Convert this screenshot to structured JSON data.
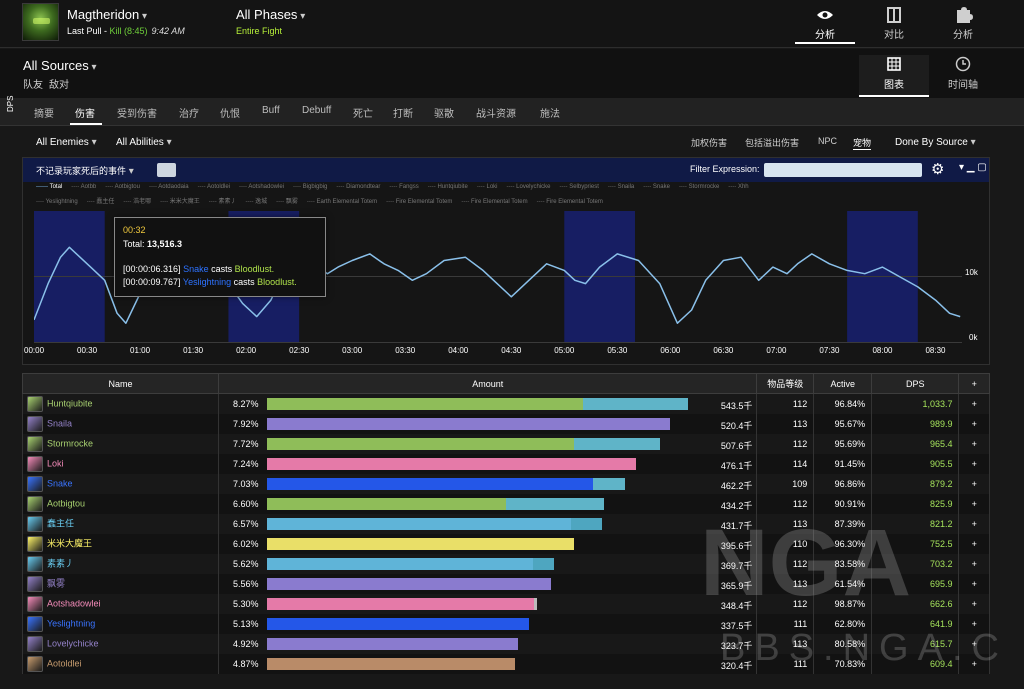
{
  "header": {
    "boss_name": "Magtheridon",
    "pull_label": "Last Pull - ",
    "kill_label": "Kill (8:45)",
    "pull_time": "9:42 AM",
    "phases": "All Phases",
    "fight": "Entire Fight",
    "nav": [
      {
        "label": "分析",
        "icon": "eye-icon",
        "active": true
      },
      {
        "label": "对比",
        "icon": "compare-icon",
        "active": false
      },
      {
        "label": "分析",
        "icon": "puzzle-icon",
        "active": false
      }
    ]
  },
  "sources": {
    "label": "All Sources",
    "teams": [
      "队友",
      "敌对"
    ],
    "views": [
      {
        "label": "图表",
        "icon": "table-icon",
        "active": true
      },
      {
        "label": "时间轴",
        "icon": "clock-icon",
        "active": false
      }
    ]
  },
  "tabs": [
    "摘要",
    "伤害",
    "受到伤害",
    "治疗",
    "仇恨",
    "Buff",
    "Debuff",
    "死亡",
    "打断",
    "驱散",
    "战斗资源",
    "施法"
  ],
  "active_tab": "伤害",
  "filters": {
    "enemies": "All Enemies",
    "abilities": "All Abilities",
    "options": [
      "加权伤害",
      "包括溢出伤害",
      "NPC",
      "宠物"
    ],
    "active_option": "宠物",
    "done_by": "Done By Source"
  },
  "chart_controls": {
    "deaths_toggle": "不记录玩家死后的事件",
    "filter_label": "Filter Expression:",
    "filter_value": "",
    "gear": "⚙",
    "window_controls": "▾ ▁ ▢"
  },
  "chart_data": {
    "type": "line",
    "title": "",
    "xlabel": "",
    "ylabel": "DPS",
    "x_ticks": [
      "00:00",
      "00:30",
      "01:00",
      "01:30",
      "02:00",
      "02:30",
      "03:00",
      "03:30",
      "04:00",
      "04:30",
      "05:00",
      "05:30",
      "06:00",
      "06:30",
      "07:00",
      "07:30",
      "08:00",
      "08:30"
    ],
    "y_ticks": [
      "0k",
      "10k"
    ],
    "ylim": [
      0,
      20000
    ],
    "legend": [
      [
        "Total",
        "Aotbb",
        "Aotbigtou",
        "Aotdaodaia",
        "Aotoldlei",
        "Aotshadowlei",
        "Bigbigbig",
        "Diamondtear",
        "Fangss",
        "Huntqiubite",
        "Loki",
        "Lovelychicke",
        "Selbypriest",
        "Snaila",
        "Snake",
        "Stormrocke",
        "Xhh"
      ],
      [
        "Yeslightning",
        "蠢主任",
        "浩老哪",
        "米米大魔王",
        "素素丿",
        "逸城",
        "飘雾",
        "Earth Elemental Totem",
        "Fire Elemental Totem",
        "Fire Elemental Totem",
        "Fire Elemental Totem"
      ]
    ],
    "bloodlust_windows_s": [
      [
        0,
        40
      ],
      [
        110,
        150
      ],
      [
        300,
        340
      ],
      [
        460,
        500
      ]
    ],
    "series": [
      {
        "name": "Total",
        "x": [
          0,
          8,
          15,
          20,
          26,
          32,
          40,
          47,
          52,
          60,
          68,
          78,
          90,
          100,
          110,
          118,
          126,
          134,
          142,
          150,
          158,
          166,
          172,
          180,
          190,
          198,
          206,
          214,
          222,
          232,
          244,
          254,
          262,
          270,
          280,
          290,
          300,
          306,
          312,
          320,
          330,
          342,
          354,
          364,
          372,
          380,
          390,
          400,
          410,
          418,
          426,
          432,
          440,
          450,
          460,
          470,
          480,
          490,
          500,
          510,
          518,
          524
        ],
        "values": [
          3500,
          9000,
          13000,
          14500,
          13000,
          11500,
          9500,
          4500,
          3000,
          7500,
          11500,
          13500,
          12500,
          11000,
          9000,
          6000,
          4000,
          6500,
          11000,
          13000,
          12000,
          10500,
          11500,
          12500,
          13500,
          12000,
          11000,
          9500,
          10500,
          12500,
          13000,
          11000,
          9000,
          7000,
          9500,
          12000,
          11000,
          9500,
          9000,
          11500,
          13500,
          12500,
          9000,
          3000,
          5000,
          9500,
          12500,
          13000,
          9500,
          11500,
          10500,
          12000,
          13500,
          12000,
          11000,
          10500,
          11500,
          10000,
          8500,
          6500,
          4500,
          4000
        ]
      }
    ],
    "tooltip": {
      "time": "00:32",
      "total_label": "Total:",
      "total_value": "13,516.3",
      "events": [
        {
          "time": "[00:00:06.316]",
          "name": "Snake",
          "verb": "casts",
          "spell": "Bloodlust."
        },
        {
          "time": "[00:00:09.767]",
          "name": "Yeslightning",
          "verb": "casts",
          "spell": "Bloodlust."
        }
      ]
    }
  },
  "table": {
    "headers": [
      "Name",
      "Amount",
      "物品等级",
      "Active",
      "DPS",
      "+"
    ],
    "max_amount": 560,
    "rows": [
      {
        "name": "Huntqiubite",
        "color": "#a9d271",
        "pct": "8.27%",
        "amount": "543.5千",
        "amount_k": 543.5,
        "main_frac": 0.75,
        "main_color": "#8fbd59",
        "extra_color": "#5fb4c8",
        "ilvl": "112",
        "active": "96.84%",
        "dps": "1,033.7",
        "plus": "+"
      },
      {
        "name": "Snaila",
        "color": "#9482c9",
        "pct": "7.92%",
        "amount": "520.4千",
        "amount_k": 520.4,
        "main_frac": 1.0,
        "main_color": "#8a7bcf",
        "extra_color": "#8a7bcf",
        "ilvl": "113",
        "active": "95.67%",
        "dps": "989.9",
        "plus": "+"
      },
      {
        "name": "Stormrocke",
        "color": "#a9d271",
        "pct": "7.72%",
        "amount": "507.6千",
        "amount_k": 507.6,
        "main_frac": 0.78,
        "main_color": "#8fbd59",
        "extra_color": "#5fb4c8",
        "ilvl": "112",
        "active": "95.69%",
        "dps": "965.4",
        "plus": "+"
      },
      {
        "name": "Loki",
        "color": "#f58cba",
        "pct": "7.24%",
        "amount": "476.1千",
        "amount_k": 476.1,
        "main_frac": 1.0,
        "main_color": "#e57aa8",
        "extra_color": "#e57aa8",
        "ilvl": "114",
        "active": "91.45%",
        "dps": "905.5",
        "plus": "+"
      },
      {
        "name": "Snake",
        "color": "#3a74ff",
        "pct": "7.03%",
        "amount": "462.2千",
        "amount_k": 462.2,
        "main_frac": 0.91,
        "main_color": "#2457e8",
        "extra_color": "#5fb4c8",
        "ilvl": "109",
        "active": "96.86%",
        "dps": "879.2",
        "plus": "+"
      },
      {
        "name": "Aotbigtou",
        "color": "#a9d271",
        "pct": "6.60%",
        "amount": "434.2千",
        "amount_k": 434.2,
        "main_frac": 0.71,
        "main_color": "#8fbd59",
        "extra_color": "#5fb4c8",
        "ilvl": "112",
        "active": "90.91%",
        "dps": "825.9",
        "plus": "+"
      },
      {
        "name": "蠢主任",
        "color": "#69ccf0",
        "pct": "6.57%",
        "amount": "431.7千",
        "amount_k": 431.7,
        "main_frac": 0.91,
        "main_color": "#5fb4d8",
        "extra_color": "#4ea6c0",
        "ilvl": "113",
        "active": "87.39%",
        "dps": "821.2",
        "plus": "+"
      },
      {
        "name": "米米大魔王",
        "color": "#fff569",
        "pct": "6.02%",
        "amount": "395.6千",
        "amount_k": 395.6,
        "main_frac": 1.0,
        "main_color": "#e9df68",
        "extra_color": "#e9df68",
        "ilvl": "110",
        "active": "96.30%",
        "dps": "752.5",
        "plus": "+"
      },
      {
        "name": "素素丿",
        "color": "#69ccf0",
        "pct": "5.62%",
        "amount": "369.7千",
        "amount_k": 369.7,
        "main_frac": 0.93,
        "main_color": "#5fb4d8",
        "extra_color": "#4ea6c0",
        "ilvl": "112",
        "active": "83.58%",
        "dps": "703.2",
        "plus": "+"
      },
      {
        "name": "飘雾",
        "color": "#9482c9",
        "pct": "5.56%",
        "amount": "365.9千",
        "amount_k": 365.9,
        "main_frac": 1.0,
        "main_color": "#8a7bcf",
        "extra_color": "#8a7bcf",
        "ilvl": "113",
        "active": "61.54%",
        "dps": "695.9",
        "plus": "+"
      },
      {
        "name": "Aotshadowlei",
        "color": "#f58cba",
        "pct": "5.30%",
        "amount": "348.4千",
        "amount_k": 348.4,
        "main_frac": 0.99,
        "main_color": "#e57aa8",
        "extra_color": "#bbbbbb",
        "ilvl": "112",
        "active": "98.87%",
        "dps": "662.6",
        "plus": "+"
      },
      {
        "name": "Yeslightning",
        "color": "#3a74ff",
        "pct": "5.13%",
        "amount": "337.5千",
        "amount_k": 337.5,
        "main_frac": 1.0,
        "main_color": "#2457e8",
        "extra_color": "#2457e8",
        "ilvl": "111",
        "active": "62.80%",
        "dps": "641.9",
        "plus": "+"
      },
      {
        "name": "Lovelychicke",
        "color": "#9482c9",
        "pct": "4.92%",
        "amount": "323.7千",
        "amount_k": 323.7,
        "main_frac": 1.0,
        "main_color": "#8a7bcf",
        "extra_color": "#8a7bcf",
        "ilvl": "113",
        "active": "80.58%",
        "dps": "615.7",
        "plus": "+"
      },
      {
        "name": "Aotoldlei",
        "color": "#c79c6e",
        "pct": "4.87%",
        "amount": "320.4千",
        "amount_k": 320.4,
        "main_frac": 1.0,
        "main_color": "#b98b68",
        "extra_color": "#b98b68",
        "ilvl": "111",
        "active": "70.83%",
        "dps": "609.4",
        "plus": "+"
      }
    ]
  },
  "watermark": {
    "logo": "NGA",
    "url": "BBS.NGA.CN"
  }
}
